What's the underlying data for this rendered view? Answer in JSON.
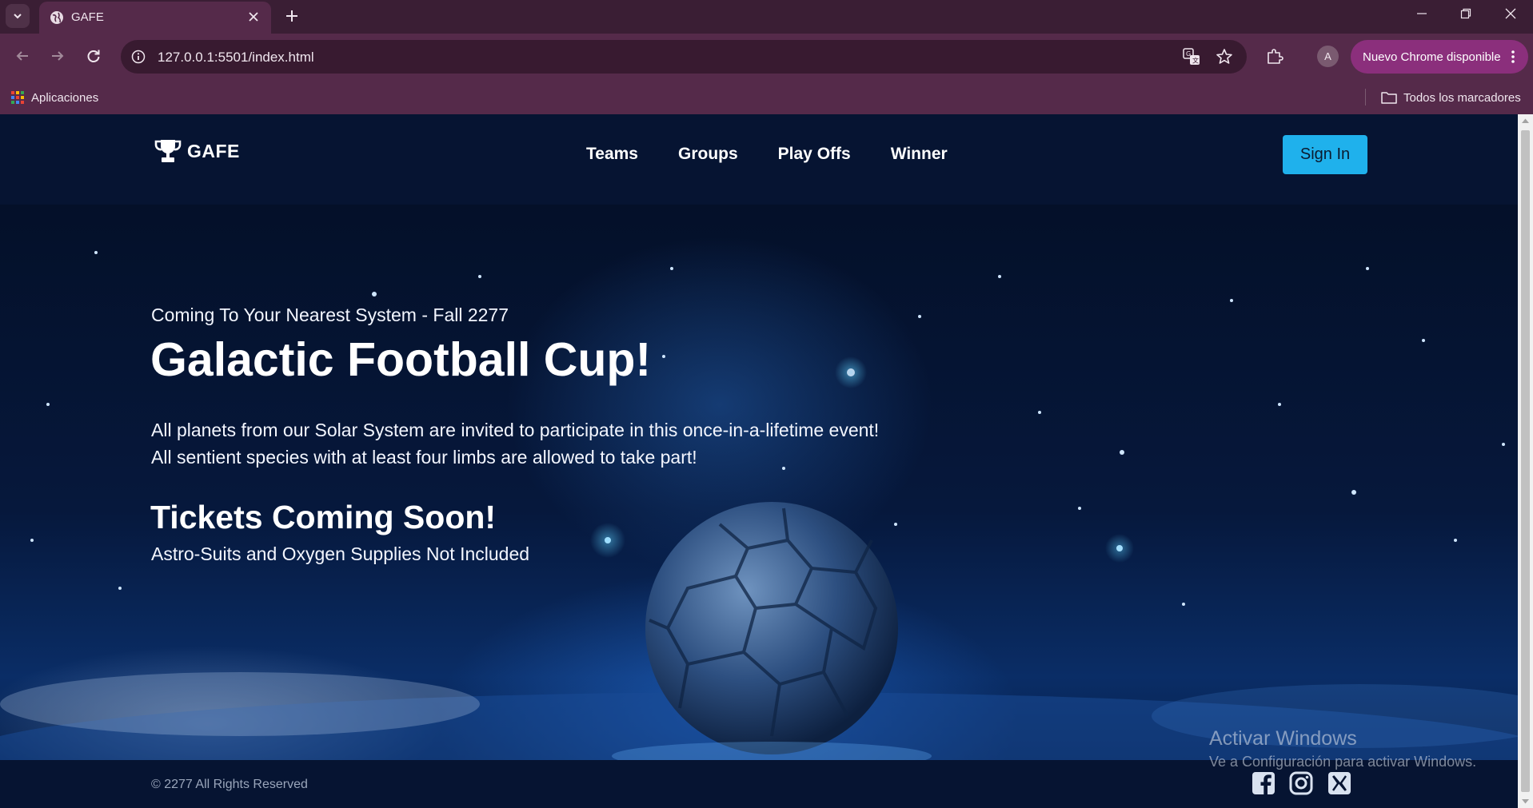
{
  "browser": {
    "tab": {
      "title": "GAFE"
    },
    "address": {
      "url": "127.0.0.1:5501/index.html"
    },
    "profile_initial": "A",
    "update_button": "Nuevo Chrome disponible",
    "bookmarks": {
      "apps_label": "Aplicaciones",
      "all_bookmarks_label": "Todos los marcadores"
    }
  },
  "site": {
    "brand": "GAFE",
    "nav": [
      "Teams",
      "Groups",
      "Play Offs",
      "Winner"
    ],
    "sign_in": "Sign In"
  },
  "hero": {
    "subtitle": "Coming To Your Nearest System - Fall 2277",
    "title": "Galactic Football Cup!",
    "lines": [
      "All planets from our Solar System are invited to participate in this once-in-a-lifetime event!",
      "All sentient species with at least four limbs are allowed to take part!"
    ],
    "tickets_heading": "Tickets Coming Soon!",
    "tickets_note": "Astro-Suits and Oxygen Supplies Not Included"
  },
  "footer": {
    "copyright": "© 2277 All Rights Reserved",
    "social": [
      "facebook-icon",
      "instagram-icon",
      "x-icon"
    ]
  },
  "watermark": {
    "title": "Activar Windows",
    "subtitle": "Ve a Configuración para activar Windows."
  },
  "colors": {
    "chrome_frame": "#3a1e34",
    "chrome_toolbar": "#552a4a",
    "site_bg": "#061432",
    "sign_in_bg": "#1fb1ec",
    "update_button": "#8b2f7c"
  }
}
